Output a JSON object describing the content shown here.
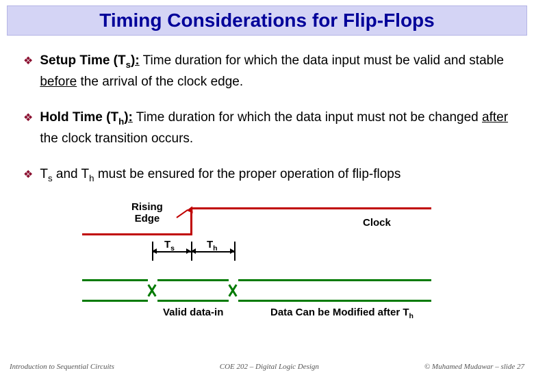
{
  "title": "Timing Considerations for Flip-Flops",
  "bullets": {
    "setup": {
      "term_prefix": "Setup Time (T",
      "term_sub": "s",
      "term_suffix": "):",
      "text_a": " Time duration for which the data input must be valid and stable ",
      "underlined": "before",
      "text_b": " the arrival of the clock edge."
    },
    "hold": {
      "term_prefix": "Hold Time (T",
      "term_sub": "h",
      "term_suffix": "):",
      "text_a": " Time duration for which the data input must not be changed ",
      "underlined": "after",
      "text_b": " the clock transition occurs."
    },
    "note": {
      "a": "T",
      "asub": "s",
      "b": " and T",
      "bsub": "h",
      "c": " must be ensured for the proper operation of flip-flops"
    }
  },
  "diagram": {
    "rising_edge_l1": "Rising",
    "rising_edge_l2": "Edge",
    "clock": "Clock",
    "ts": "T",
    "ts_sub": "s",
    "th": "T",
    "th_sub": "h",
    "valid": "Valid data-in",
    "modify": "Data Can be Modified after T",
    "modify_sub": "h"
  },
  "footer": {
    "left": "Introduction to Sequential Circuits",
    "center": "COE 202 – Digital Logic Design",
    "right": "© Muhamed Mudawar – slide 27"
  }
}
